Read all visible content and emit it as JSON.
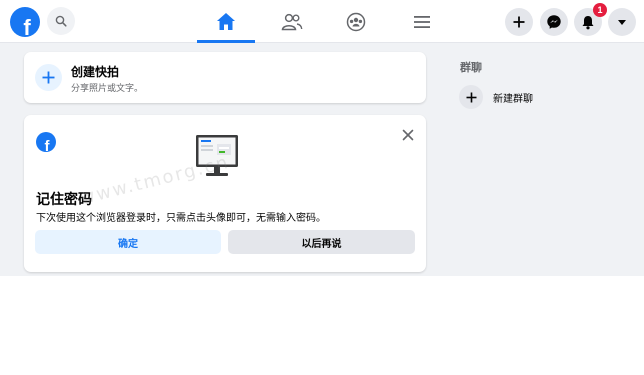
{
  "topbar": {
    "logo_letter": "f",
    "notification_count": "1"
  },
  "story": {
    "title": "创建快拍",
    "subtitle": "分享照片或文字。"
  },
  "password_prompt": {
    "title": "记住密码",
    "description": "下次使用这个浏览器登录时，只需点击头像即可，无需输入密码。",
    "confirm_label": "确定",
    "later_label": "以后再说"
  },
  "right_column": {
    "section_title": "群聊",
    "new_group_label": "新建群聊"
  },
  "watermark": "www.tmorg.cn",
  "colors": {
    "brand": "#1877f2",
    "badge": "#e41e3f",
    "background": "#f0f2f5"
  }
}
